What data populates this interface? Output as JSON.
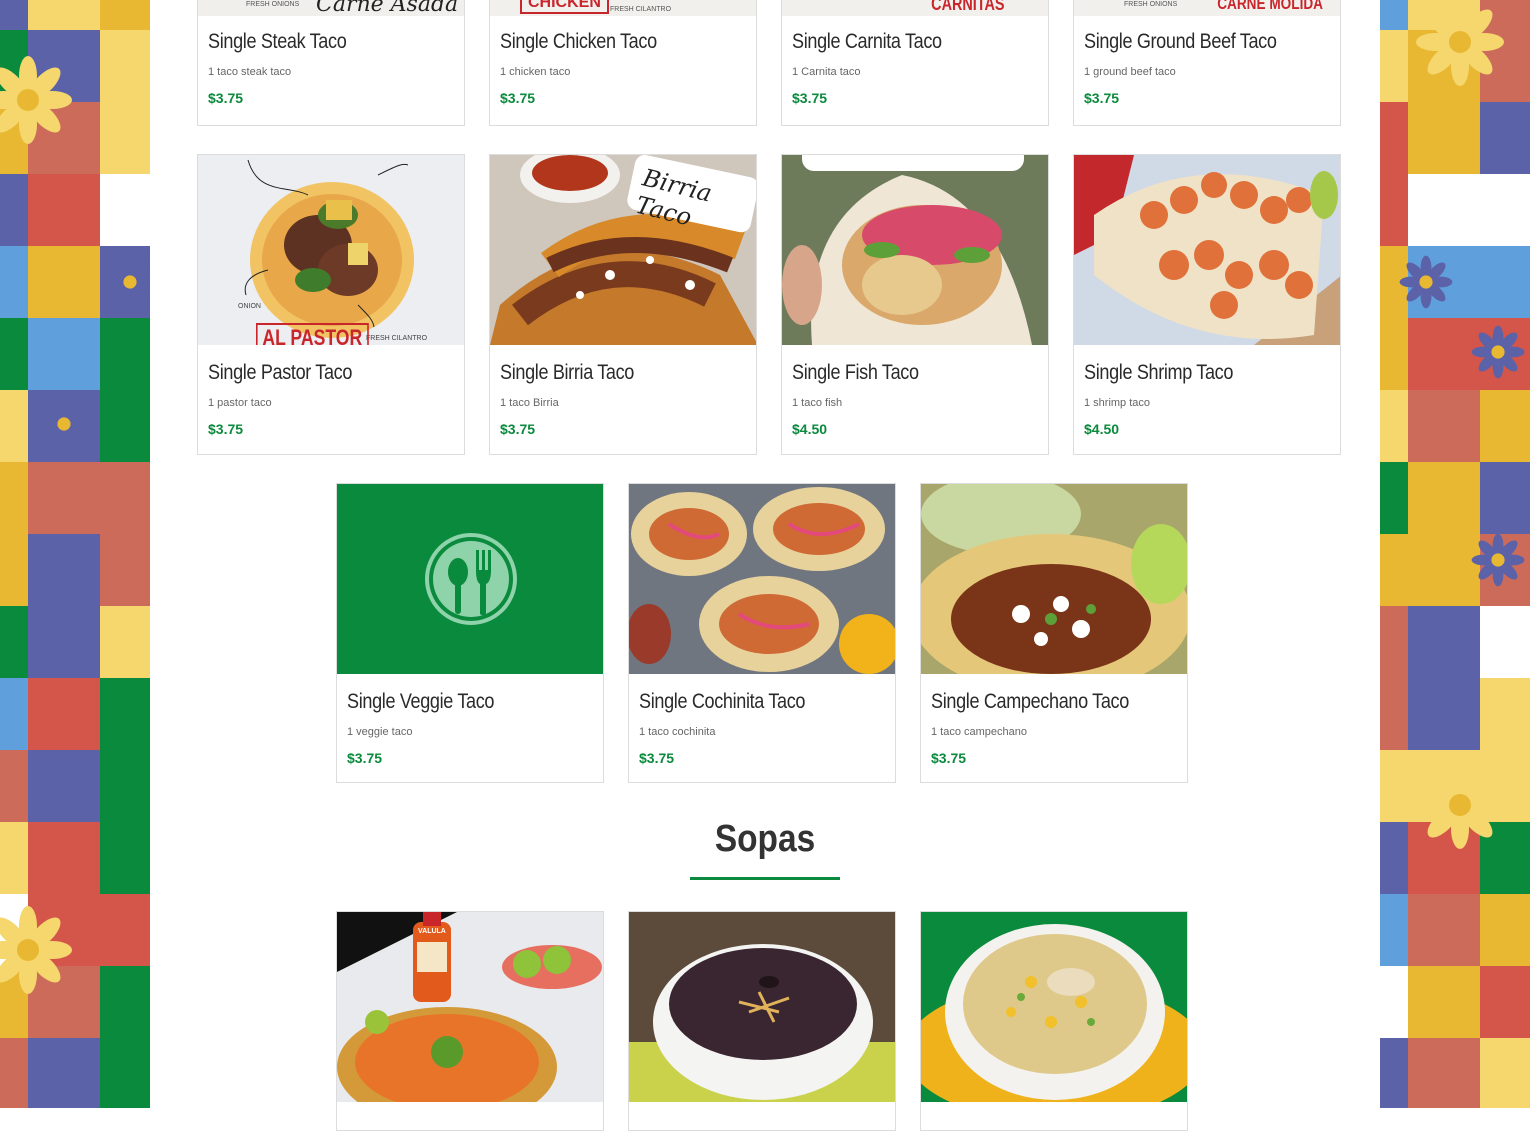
{
  "theme": {
    "accent": "#0a8a3c",
    "mosaic_colors": [
      "#e9b832",
      "#0a8a3c",
      "#d4564a",
      "#5b62a8",
      "#f5d76e",
      "#5fa0dc",
      "#ffffff",
      "#cc6b5a"
    ]
  },
  "menu": {
    "tacos_row1": [
      {
        "name": "Single Steak Taco",
        "desc": "1 taco steak taco",
        "price": "$3.75",
        "photo_caption": "Carne Asada",
        "photo_note": "FRESH ONIONS"
      },
      {
        "name": "Single Chicken Taco",
        "desc": "1 chicken taco",
        "price": "$3.75",
        "photo_caption": "CHICKEN",
        "photo_note": "FRESH CILANTRO"
      },
      {
        "name": "Single Carnita Taco",
        "desc": "1 Carnita taco",
        "price": "$3.75",
        "photo_caption": "CARNITAS",
        "photo_note": ""
      },
      {
        "name": "Single Ground Beef Taco",
        "desc": "1 ground beef taco",
        "price": "$3.75",
        "photo_caption": "CARNE MOLIDA",
        "photo_note": "FRESH ONIONS"
      }
    ],
    "tacos_row2": [
      {
        "name": "Single Pastor Taco",
        "desc": "1 pastor taco",
        "price": "$3.75",
        "photo_caption": "AL PASTOR",
        "photo_note_1": "ONION",
        "photo_note_2": "FRESH CILANTRO"
      },
      {
        "name": "Single Birria Taco",
        "desc": "1 taco Birria",
        "price": "$3.75",
        "photo_caption": "Birria Taco"
      },
      {
        "name": "Single Fish Taco",
        "desc": "1 taco fish",
        "price": "$4.50"
      },
      {
        "name": "Single Shrimp Taco",
        "desc": "1 shrimp taco",
        "price": "$4.50"
      }
    ],
    "tacos_row3": [
      {
        "name": "Single Veggie Taco",
        "desc": "1 veggie taco",
        "price": "$3.75",
        "icon": "utensils-icon"
      },
      {
        "name": "Single Cochinita Taco",
        "desc": "1 taco cochinita",
        "price": "$3.75"
      },
      {
        "name": "Single Campechano Taco",
        "desc": "1 taco campechano",
        "price": "$3.75"
      }
    ],
    "sopas_title": "Sopas",
    "sopas_hot_sauce_label": "VALULA"
  }
}
